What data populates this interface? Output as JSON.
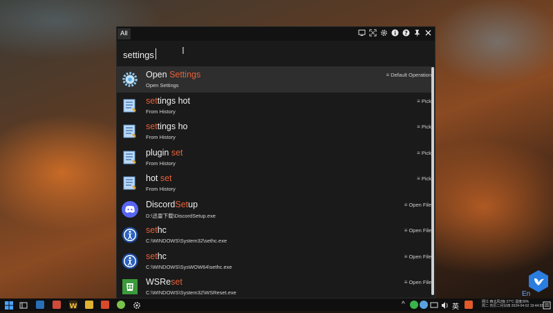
{
  "tab": {
    "label": "All"
  },
  "toolbar": {
    "icons": [
      "window-icon",
      "expand-icon",
      "gear-icon",
      "info-icon",
      "help-icon",
      "pin-icon",
      "close-icon"
    ]
  },
  "search": {
    "value": "settings",
    "cursor_glyph": "I"
  },
  "results": [
    {
      "icon": "settings-gear-icon",
      "title_pre": "Open ",
      "title_hl": "Settings",
      "title_post": "",
      "subtitle": "Open Settings",
      "action": "Default Operation",
      "selected": true
    },
    {
      "icon": "history-icon",
      "title_pre": "",
      "title_hl": "set",
      "title_post": "tings hot",
      "subtitle": "From History",
      "action": "Pick",
      "selected": false
    },
    {
      "icon": "history-icon",
      "title_pre": "",
      "title_hl": "set",
      "title_post": "tings ho",
      "subtitle": "From History",
      "action": "Pick",
      "selected": false
    },
    {
      "icon": "history-icon",
      "title_pre": "plugin ",
      "title_hl": "set",
      "title_post": "",
      "subtitle": "From History",
      "action": "Pick",
      "selected": false
    },
    {
      "icon": "history-icon",
      "title_pre": "hot ",
      "title_hl": "set",
      "title_post": "",
      "subtitle": "From History",
      "action": "Pick",
      "selected": false
    },
    {
      "icon": "discord-icon",
      "title_pre": "Discord",
      "title_hl": "Set",
      "title_post": "up",
      "subtitle": "D:\\迅雷下载\\DiscordSetup.exe",
      "action": "Open File",
      "selected": false
    },
    {
      "icon": "sethc-icon",
      "title_pre": "",
      "title_hl": "set",
      "title_post": "hc",
      "subtitle": "C:\\WINDOWS\\System32\\sethc.exe",
      "action": "Open File",
      "selected": false
    },
    {
      "icon": "sethc-icon",
      "title_pre": "",
      "title_hl": "set",
      "title_post": "hc",
      "subtitle": "C:\\WINDOWS\\SysWOW64\\sethc.exe",
      "action": "Open File",
      "selected": false
    },
    {
      "icon": "wsreset-icon",
      "title_pre": "WSRe",
      "title_hl": "set",
      "title_post": "",
      "subtitle": "C:\\WINDOWS\\System32\\WSReset.exe",
      "action": "Open File",
      "selected": false
    }
  ],
  "taskbar": {
    "tray": {
      "ime_label": "英",
      "weather": "网江 西北风2级 27°C 湿度39%",
      "datetime": "周二 农历二月廿四 2024-04-02 19:44:55"
    },
    "side_badge": "En"
  },
  "colors": {
    "highlight": "#e8603a",
    "panel": "#1a1a1a",
    "selected_row": "#2e2e2e"
  }
}
